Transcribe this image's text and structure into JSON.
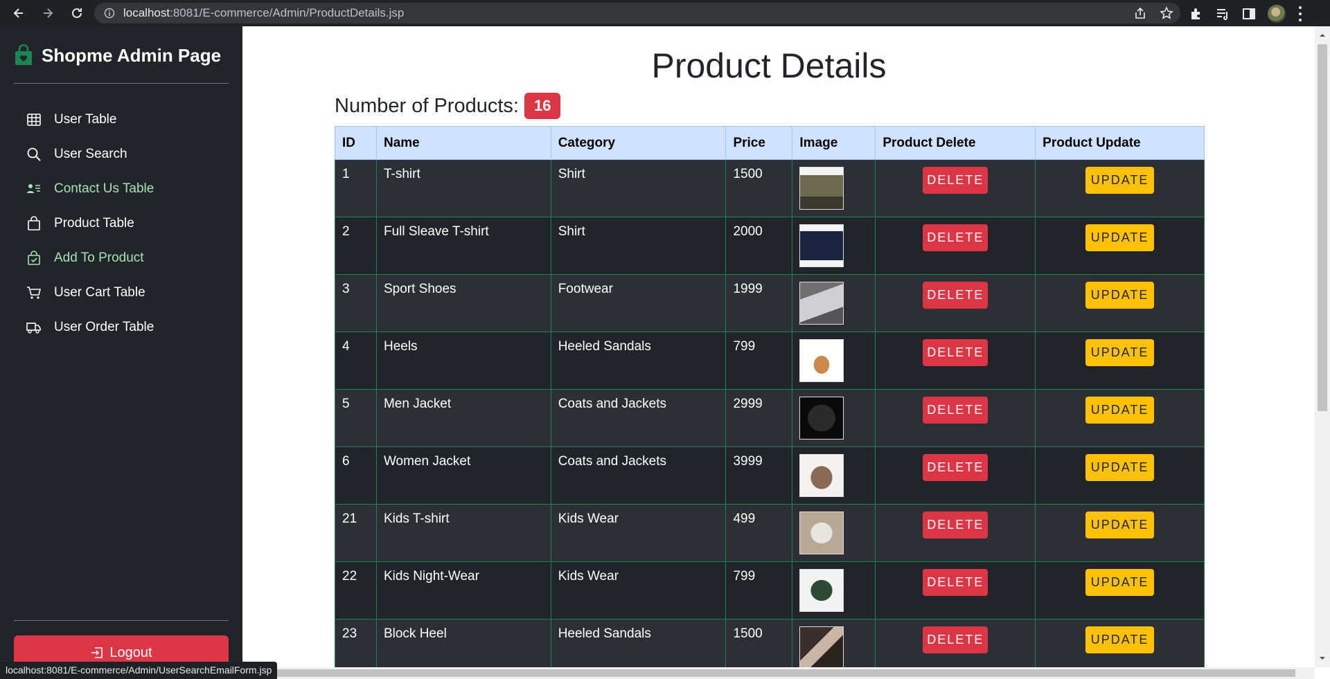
{
  "browser": {
    "url_host": "localhost",
    "url_rest": ":8081/E-commerce/Admin/ProductDetails.jsp",
    "status_url": "localhost:8081/E-commerce/Admin/UserSearchEmailForm.jsp"
  },
  "sidebar": {
    "brand": "Shopme Admin Page",
    "items": [
      {
        "label": "User Table",
        "icon": "table-icon"
      },
      {
        "label": "User Search",
        "icon": "search-icon"
      },
      {
        "label": "Contact Us Table",
        "icon": "person-lines-icon"
      },
      {
        "label": "Product Table",
        "icon": "bag-icon"
      },
      {
        "label": "Add To Product",
        "icon": "bag-check-icon"
      },
      {
        "label": "User Cart Table",
        "icon": "cart-icon"
      },
      {
        "label": "User Order Table",
        "icon": "truck-icon"
      }
    ],
    "logout_label": "Logout"
  },
  "main": {
    "title": "Product Details",
    "count_label": "Number of Products:",
    "count_value": "16",
    "columns": [
      "ID",
      "Name",
      "Category",
      "Price",
      "Image",
      "Product Delete",
      "Product Update"
    ],
    "delete_label": "DELETE",
    "update_label": "UPDATE",
    "rows": [
      {
        "id": "1",
        "name": "T-shirt",
        "category": "Shirt",
        "price": "1500"
      },
      {
        "id": "2",
        "name": "Full Sleave T-shirt",
        "category": "Shirt",
        "price": "2000"
      },
      {
        "id": "3",
        "name": "Sport Shoes",
        "category": "Footwear",
        "price": "1999"
      },
      {
        "id": "4",
        "name": "Heels",
        "category": "Heeled Sandals",
        "price": "799"
      },
      {
        "id": "5",
        "name": "Men Jacket",
        "category": "Coats and Jackets",
        "price": "2999"
      },
      {
        "id": "6",
        "name": "Women Jacket",
        "category": "Coats and Jackets",
        "price": "3999"
      },
      {
        "id": "21",
        "name": "Kids T-shirt",
        "category": "Kids Wear",
        "price": "499"
      },
      {
        "id": "22",
        "name": "Kids Night-Wear",
        "category": "Kids Wear",
        "price": "799"
      },
      {
        "id": "23",
        "name": "Block Heel",
        "category": "Heeled Sandals",
        "price": "1500"
      }
    ]
  },
  "colors": {
    "sidebar_bg": "#212529",
    "brand_green": "#198754",
    "danger": "#dc3545",
    "warning": "#ffc107",
    "table_header_bg": "#cfe2ff"
  }
}
